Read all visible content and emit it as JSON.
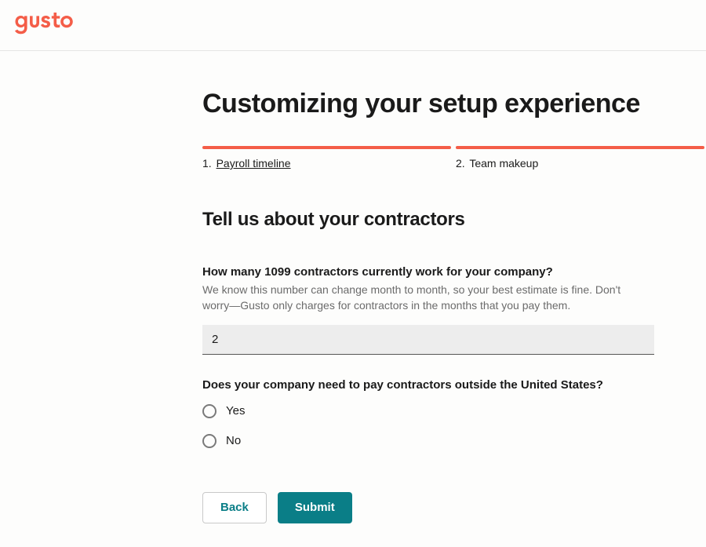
{
  "brand": {
    "name": "gusto",
    "color": "#f45d48"
  },
  "page": {
    "title": "Customizing your setup experience"
  },
  "steps": [
    {
      "number": "1.",
      "label": "Payroll timeline",
      "is_link": true
    },
    {
      "number": "2.",
      "label": "Team makeup",
      "is_link": false
    }
  ],
  "section": {
    "heading": "Tell us about your contractors"
  },
  "fields": {
    "contractor_count": {
      "label": "How many 1099 contractors currently work for your company?",
      "help": "We know this number can change month to month, so your best estimate is fine. Don't worry—Gusto only charges for contractors in the months that you pay them.",
      "value": "2"
    },
    "international": {
      "label": "Does your company need to pay contractors outside the United States?",
      "options": [
        {
          "value": "yes",
          "label": "Yes"
        },
        {
          "value": "no",
          "label": "No"
        }
      ],
      "selected": null
    }
  },
  "actions": {
    "back": "Back",
    "submit": "Submit"
  },
  "colors": {
    "accent": "#f45d48",
    "primary_button": "#0a7e87"
  }
}
